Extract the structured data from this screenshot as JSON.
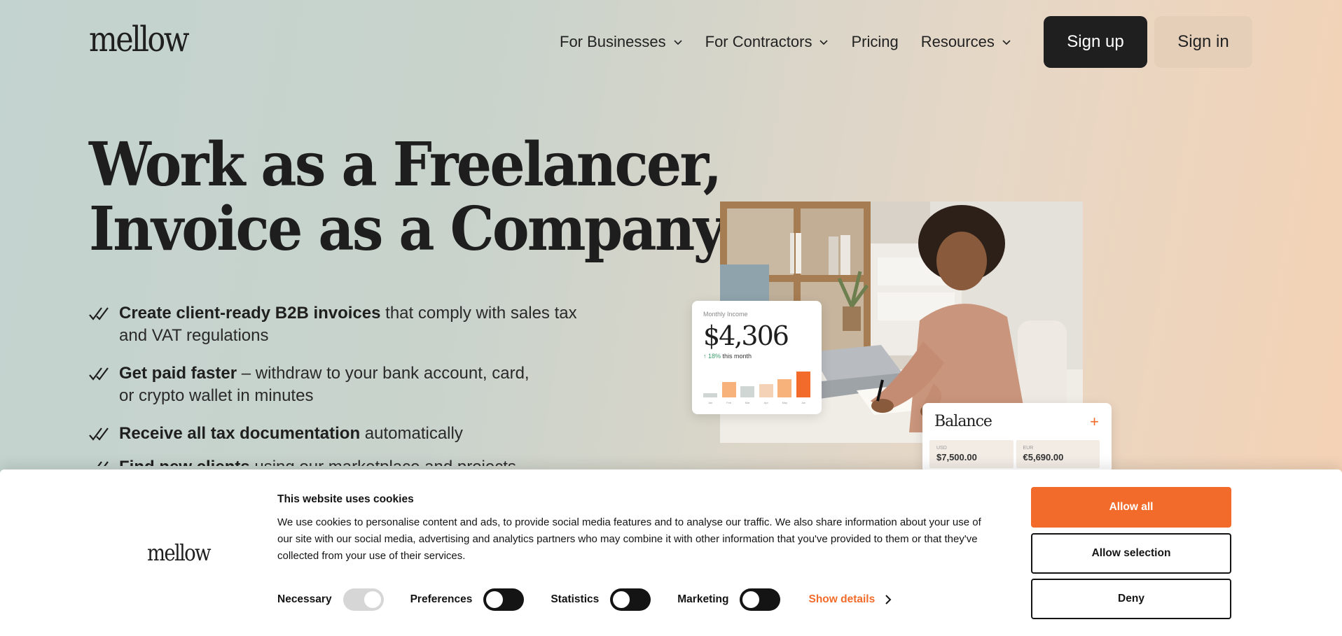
{
  "brand": {
    "logo_text": "mellow"
  },
  "nav": {
    "items": [
      {
        "label": "For Businesses",
        "has_dropdown": true
      },
      {
        "label": "For Contractors",
        "has_dropdown": true
      },
      {
        "label": "Pricing",
        "has_dropdown": false
      },
      {
        "label": "Resources",
        "has_dropdown": true
      }
    ],
    "signup_label": "Sign up",
    "signin_label": "Sign in"
  },
  "hero": {
    "title_line1": "Work as a Freelancer,",
    "title_line2": "Invoice as a Company",
    "features": [
      {
        "bold": "Create client-ready B2B invoices",
        "line1_rest": " that comply with sales tax",
        "line2": "and VAT regulations"
      },
      {
        "bold": "Get paid faster",
        "line1_rest": " – withdraw to your bank account, card,",
        "line2": "or crypto wallet in minutes"
      },
      {
        "bold": "Receive all tax documentation",
        "line1_rest": " automatically",
        "line2": ""
      },
      {
        "bold": "Find new clients",
        "line1_rest": " using our marketplace and projects",
        "line2": ""
      }
    ]
  },
  "income_card": {
    "label": "Monthly Income",
    "amount": "$4,306",
    "delta_arrow": "↑",
    "delta_pct": "18%",
    "delta_text": " this month",
    "bars": [
      {
        "month": "Jan",
        "value": 0.12,
        "color": "#cfd6d3"
      },
      {
        "month": "Feb",
        "value": 0.48,
        "color": "#f6b27a"
      },
      {
        "month": "Mar",
        "value": 0.34,
        "color": "#cfd6d3"
      },
      {
        "month": "Apr",
        "value": 0.42,
        "color": "#f3d2b5"
      },
      {
        "month": "May",
        "value": 0.56,
        "color": "#f6b27a"
      },
      {
        "month": "Jun",
        "value": 0.8,
        "color": "#f26b2a"
      }
    ]
  },
  "balance_card": {
    "title": "Balance",
    "plus": "+",
    "tiles": [
      {
        "currency": "USD",
        "value": "$7,500.00"
      },
      {
        "currency": "EUR",
        "value": "€5,690.00"
      }
    ]
  },
  "cookie": {
    "logo_text": "mellow",
    "title": "This website uses cookies",
    "text": "We use cookies to personalise content and ads, to provide social media features and to analyse our traffic. We also share information about your use of our site with our social media, advertising and analytics partners who may combine it with other information that you've provided to them or that they've collected from your use of their services.",
    "consents": [
      {
        "label": "Necessary",
        "on": true
      },
      {
        "label": "Preferences",
        "on": false
      },
      {
        "label": "Statistics",
        "on": false
      },
      {
        "label": "Marketing",
        "on": false
      }
    ],
    "show_details_label": "Show details",
    "allow_all_label": "Allow all",
    "allow_selection_label": "Allow selection",
    "deny_label": "Deny",
    "accent_color": "#f26b2a"
  }
}
